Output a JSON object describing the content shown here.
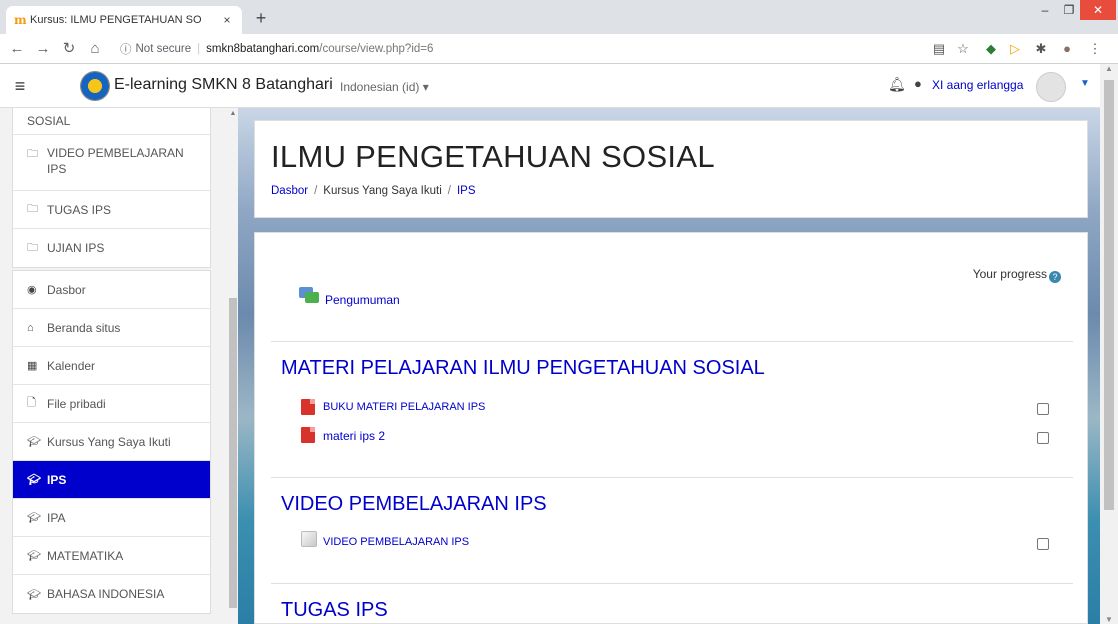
{
  "browser": {
    "tab_title": "Kursus: ILMU PENGETAHUAN SO",
    "tab_close": "×",
    "new_tab": "+",
    "security_label": "Not secure",
    "url_host": "smkn8batanghari.com",
    "url_path": "/course/view.php?id=6"
  },
  "navbar": {
    "site_name": "E-learning SMKN 8 Batanghari",
    "language": "Indonesian (id) ▾",
    "user_name": "XI aang erlangga"
  },
  "drawer": {
    "course_items": [
      {
        "label": "SOSIAL"
      },
      {
        "label": "VIDEO PEMBELAJARAN IPS"
      },
      {
        "label": "TUGAS IPS"
      },
      {
        "label": "UJIAN IPS"
      }
    ],
    "nav_items": [
      {
        "label": "Dasbor"
      },
      {
        "label": "Beranda situs"
      },
      {
        "label": "Kalender"
      },
      {
        "label": "File pribadi"
      },
      {
        "label": "Kursus Yang Saya Ikuti"
      },
      {
        "label": "IPS"
      },
      {
        "label": "IPA"
      },
      {
        "label": "MATEMATIKA"
      },
      {
        "label": "BAHASA INDONESIA"
      }
    ]
  },
  "header": {
    "title": "ILMU PENGETAHUAN SOSIAL",
    "breadcrumb": [
      "Dasbor",
      "Kursus Yang Saya Ikuti",
      "IPS"
    ],
    "breadcrumb_sep": "/"
  },
  "course": {
    "progress_label": "Your progress",
    "announcement": "Pengumuman",
    "sections": [
      {
        "title": "MATERI PELAJARAN ILMU PENGETAHUAN SOSIAL",
        "activities": [
          "BUKU MATERI PELAJARAN IPS",
          "materi ips 2"
        ]
      },
      {
        "title": "VIDEO PEMBELAJARAN IPS",
        "activities": [
          "VIDEO PEMBELAJARAN IPS"
        ]
      },
      {
        "title": "TUGAS IPS",
        "activities": []
      }
    ]
  },
  "colors": {
    "link": "#0000cc",
    "active_nav": "#0000cc"
  }
}
